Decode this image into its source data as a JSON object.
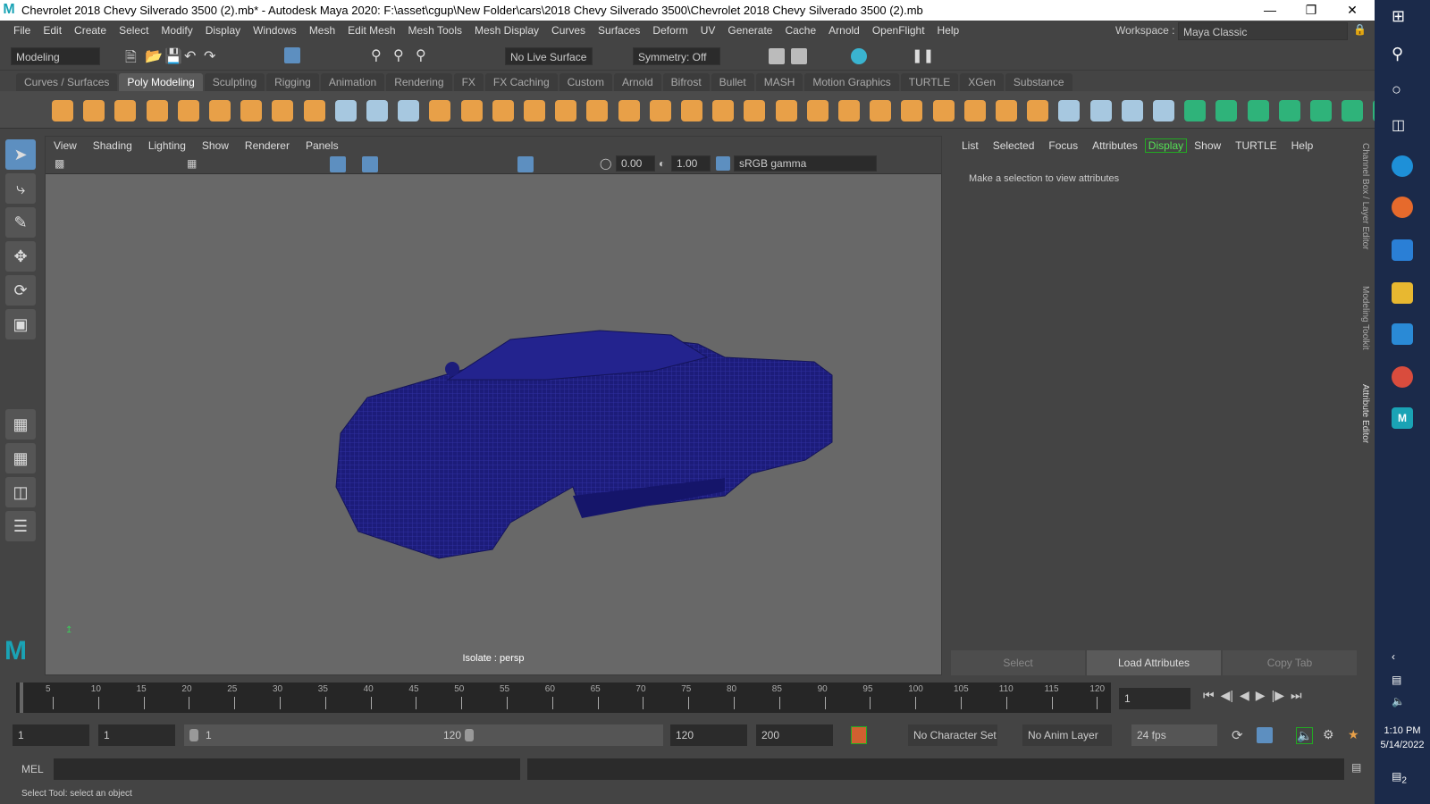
{
  "title": "Chevrolet 2018 Chevy Silverado 3500 (2).mb* - Autodesk Maya 2020: F:\\asset\\cgup\\New Folder\\cars\\2018 Chevy Silverado 3500\\Chevrolet 2018 Chevy Silverado 3500 (2).mb",
  "menus": [
    "File",
    "Edit",
    "Create",
    "Select",
    "Modify",
    "Display",
    "Windows",
    "Mesh",
    "Edit Mesh",
    "Mesh Tools",
    "Mesh Display",
    "Curves",
    "Surfaces",
    "Deform",
    "UV",
    "Generate",
    "Cache",
    "Arnold",
    "OpenFlight",
    "Help"
  ],
  "workspace_label": "Workspace :",
  "workspace": "Maya Classic",
  "mode": "Modeling",
  "live_surface": "No Live Surface",
  "symmetry": "Symmetry: Off",
  "shelf_tabs": [
    "Curves / Surfaces",
    "Poly Modeling",
    "Sculpting",
    "Rigging",
    "Animation",
    "Rendering",
    "FX",
    "FX Caching",
    "Custom",
    "Arnold",
    "Bifrost",
    "Bullet",
    "MASH",
    "Motion Graphics",
    "TURTLE",
    "XGen",
    "Substance"
  ],
  "active_shelf": "Poly Modeling",
  "viewport": {
    "menus": [
      "View",
      "Shading",
      "Lighting",
      "Show",
      "Renderer",
      "Panels"
    ],
    "exposure": "0.00",
    "gamma": "1.00",
    "color_space": "sRGB gamma",
    "label": "Isolate : persp"
  },
  "attr": {
    "menus": [
      "List",
      "Selected",
      "Focus",
      "Attributes",
      "Display",
      "Show",
      "TURTLE",
      "Help"
    ],
    "message": "Make a selection to view attributes",
    "buttons": [
      "Select",
      "Load Attributes",
      "Copy Tab"
    ]
  },
  "side_tabs": [
    "Channel Box / Layer Editor",
    "Modeling Toolkit",
    "Attribute Editor"
  ],
  "timeline": {
    "ticks": [
      "5",
      "10",
      "15",
      "20",
      "25",
      "30",
      "35",
      "40",
      "45",
      "50",
      "55",
      "60",
      "65",
      "70",
      "75",
      "80",
      "85",
      "90",
      "95",
      "100",
      "105",
      "110",
      "115",
      "120"
    ],
    "current_frame": "1"
  },
  "range": {
    "start": "1",
    "playback_start": "1",
    "slider_start": "1",
    "slider_end": "120",
    "playback_end": "120",
    "end": "200",
    "character_set": "No Character Set",
    "anim_layer": "No Anim Layer",
    "fps": "24 fps"
  },
  "mel_label": "MEL",
  "help_line": "Select Tool: select an object",
  "clock": {
    "time": "1:10 PM",
    "date": "5/14/2022"
  },
  "notif_count": "2"
}
